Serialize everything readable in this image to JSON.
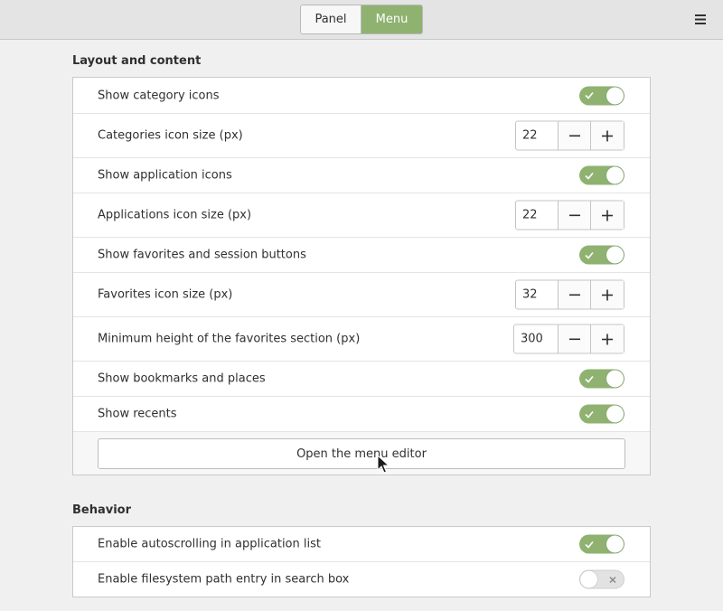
{
  "header": {
    "tabs": [
      {
        "label": "Panel",
        "active": false
      },
      {
        "label": "Menu",
        "active": true
      }
    ],
    "menu_icon": "hamburger-menu-icon"
  },
  "sections": {
    "layout": {
      "title": "Layout and content",
      "rows": [
        {
          "label": "Show category icons",
          "type": "toggle",
          "checked": true
        },
        {
          "label": "Categories icon size (px)",
          "type": "spin",
          "value": "22"
        },
        {
          "label": "Show application icons",
          "type": "toggle",
          "checked": true
        },
        {
          "label": "Applications icon size (px)",
          "type": "spin",
          "value": "22"
        },
        {
          "label": "Show favorites and session buttons",
          "type": "toggle",
          "checked": true
        },
        {
          "label": "Favorites icon size (px)",
          "type": "spin",
          "value": "32"
        },
        {
          "label": "Minimum height of the favorites section (px)",
          "type": "spin",
          "value": "300"
        },
        {
          "label": "Show bookmarks and places",
          "type": "toggle",
          "checked": true
        },
        {
          "label": "Show recents",
          "type": "toggle",
          "checked": true
        }
      ],
      "editor_button": "Open the menu editor"
    },
    "behavior": {
      "title": "Behavior",
      "rows": [
        {
          "label": "Enable autoscrolling in application list",
          "type": "toggle",
          "checked": true
        },
        {
          "label": "Enable filesystem path entry in search box",
          "type": "toggle",
          "checked": false
        }
      ]
    }
  },
  "colors": {
    "accent": "#8fb271",
    "background": "#f0f0f0",
    "panel": "#ffffff"
  }
}
